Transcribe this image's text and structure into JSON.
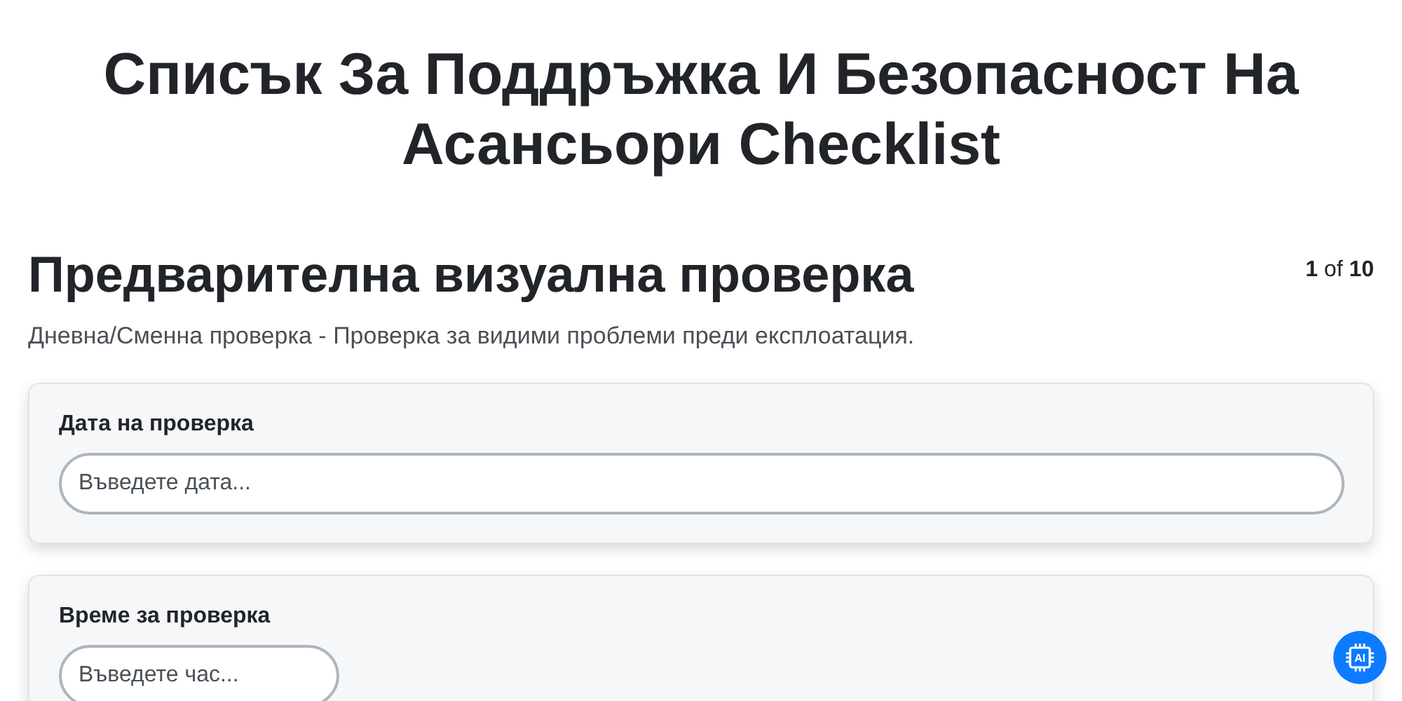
{
  "title": "Списък За Поддръжка И Безопасност На Асансьори Checklist",
  "section": {
    "heading": "Предварителна визуална проверка",
    "counter": "**1** of **10**",
    "description": "Дневна/Сменна проверка - Проверка за видими проблеми преди експлоатация."
  },
  "fields": [
    {
      "label": "Дата на проверка",
      "placeholder": "Въведете дата...",
      "kind": "wide"
    },
    {
      "label": "Време за проверка",
      "placeholder": "Въведете час...",
      "kind": "short"
    }
  ],
  "assistant_button": {
    "label": "AI"
  }
}
